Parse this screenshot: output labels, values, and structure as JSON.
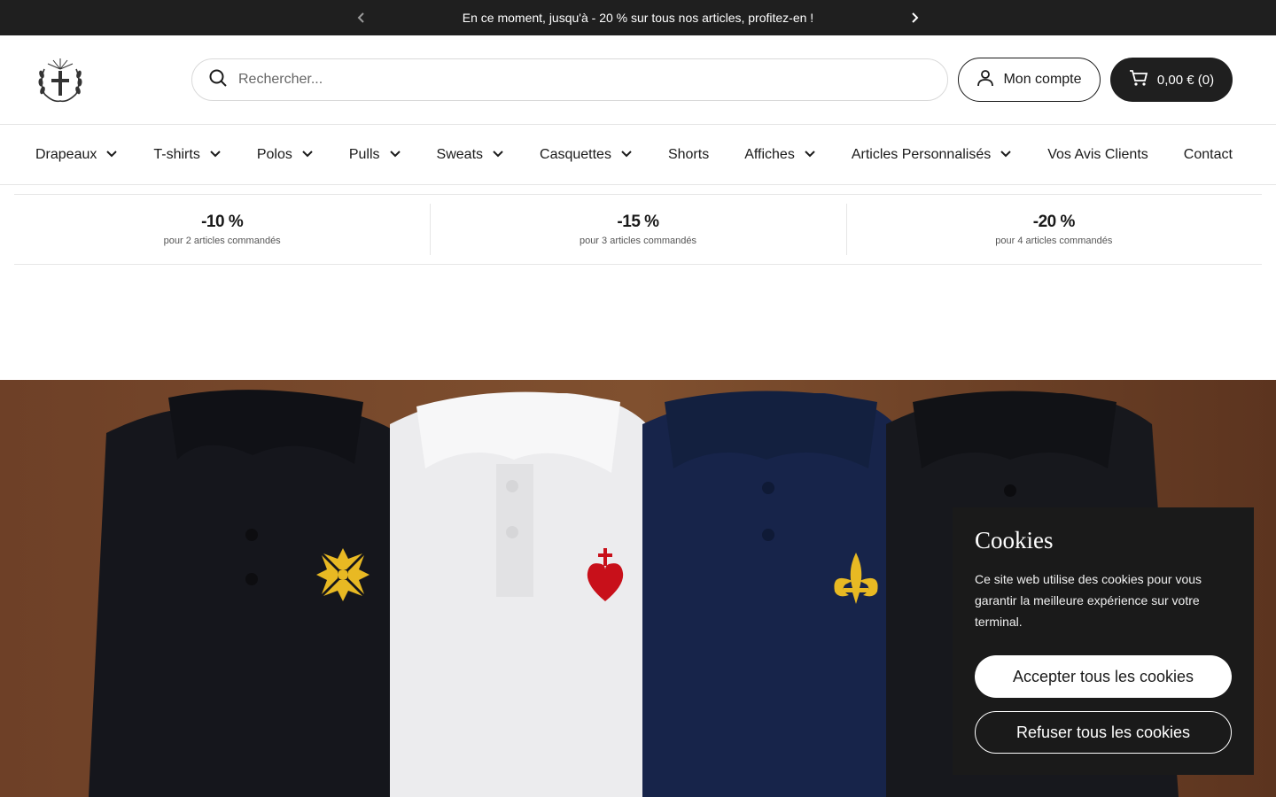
{
  "announcement": {
    "text": "En ce moment, jusqu'à - 20 % sur tous nos articles, profitez-en !"
  },
  "header": {
    "search_placeholder": "Rechercher...",
    "account_label": "Mon compte",
    "cart_label": "0,00 € (0)"
  },
  "nav": {
    "items": [
      {
        "label": "Drapeaux",
        "dropdown": true
      },
      {
        "label": "T-shirts",
        "dropdown": true
      },
      {
        "label": "Polos",
        "dropdown": true
      },
      {
        "label": "Pulls",
        "dropdown": true
      },
      {
        "label": "Sweats",
        "dropdown": true
      },
      {
        "label": "Casquettes",
        "dropdown": true
      },
      {
        "label": "Shorts",
        "dropdown": false
      },
      {
        "label": "Affiches",
        "dropdown": true
      },
      {
        "label": "Articles Personnalisés",
        "dropdown": true
      },
      {
        "label": "Vos Avis Clients",
        "dropdown": false
      },
      {
        "label": "Contact",
        "dropdown": false
      }
    ]
  },
  "discounts": [
    {
      "value": "-10 %",
      "desc": "pour 2 articles commandés"
    },
    {
      "value": "-15 %",
      "desc": "pour 3 articles commandés"
    },
    {
      "value": "-20 %",
      "desc": "pour 4 articles commandés"
    }
  ],
  "cookie": {
    "title": "Cookies",
    "text": "Ce site web utilise des cookies pour vous garantir la meilleure expérience sur votre terminal.",
    "accept_label": "Accepter tous les cookies",
    "refuse_label": "Refuser tous les cookies"
  },
  "colors": {
    "dark": "#1f1f1f",
    "wood": "#6b3e24",
    "navy": "#16234a",
    "gold": "#e8b923",
    "red": "#c8101a"
  }
}
